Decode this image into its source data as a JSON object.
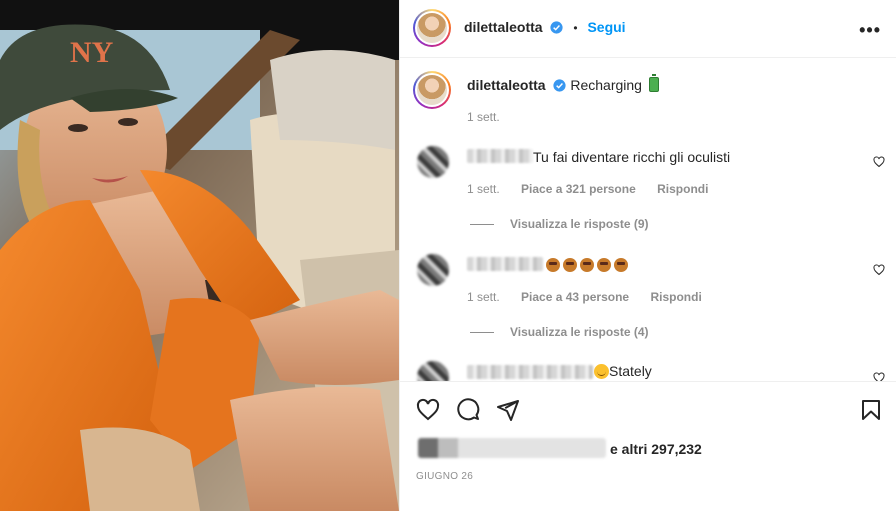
{
  "post": {
    "photo_icon": "selfie-photo",
    "author": "dilettaleotta",
    "follow_label": "Segui",
    "more_label": "•••",
    "caption": "Recharging",
    "caption_time": "1 sett."
  },
  "comments": [
    {
      "text": "Tu fai diventare ricchi gli oculisti",
      "time": "1 sett.",
      "likes": "Piace a 321 persone",
      "reply_label": "Rispondi",
      "view_replies": "Visualizza le risposte (9)"
    },
    {
      "text": "",
      "emoji_icons": [
        "money-face-emoji",
        "money-face-emoji",
        "money-face-emoji",
        "money-face-emoji",
        "money-face-emoji"
      ],
      "time": "1 sett.",
      "likes": "Piace a 43 persone",
      "reply_label": "Rispondi",
      "view_replies": "Visualizza le risposte (4)"
    },
    {
      "text": "Stately",
      "emoji_icons": [
        "smiling-face-emoji"
      ]
    }
  ],
  "footer": {
    "likes_suffix": "e altri 297,232",
    "date": "GIUGNO 26"
  },
  "colors": {
    "accent": "#0095f6",
    "text": "#262626",
    "muted": "#8e8e8e",
    "divider": "#efefef"
  }
}
